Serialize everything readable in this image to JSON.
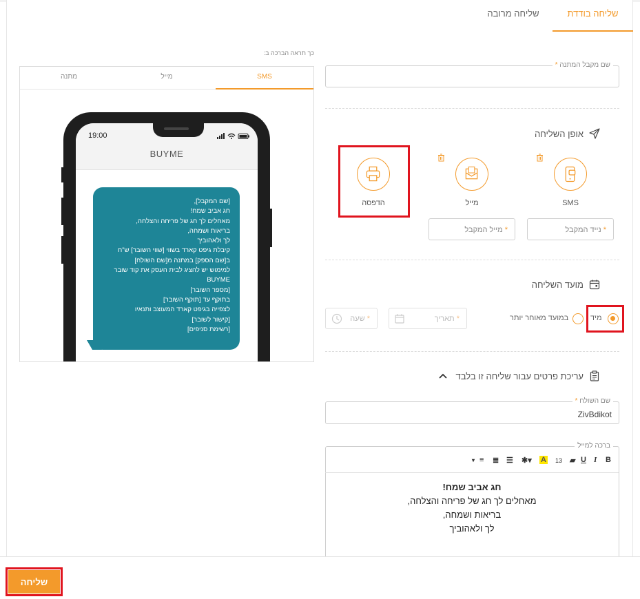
{
  "tabs": {
    "single": "שליחה בודדת",
    "multi": "שליחה מרובה"
  },
  "recipient": {
    "label": "שם מקבל המתנה",
    "required_mark": "*"
  },
  "delivery": {
    "title": "אופן השליחה",
    "options": [
      {
        "label": "SMS",
        "icon": "sms-phone-icon"
      },
      {
        "label": "מייל",
        "icon": "email-icon"
      },
      {
        "label": "הדפסה",
        "icon": "printer-icon"
      }
    ],
    "phone_field": "נייד המקבל",
    "email_field": "מייל המקבל"
  },
  "timing": {
    "title": "מועד השליחה",
    "now": "מיד",
    "later": "במועד מאוחר יותר",
    "date": "תאריך",
    "time": "שעה"
  },
  "edit": {
    "title": "עריכת פרטים עבור שליחה זו בלבד",
    "sender_label": "שם השולח",
    "sender_value": "ZivBdikot",
    "blessing_label": "ברכה למייל",
    "font_size": "13",
    "blessing_lines": [
      "חג אביב שמח!",
      "מאחלים לך חג של פריחה והצלחה,",
      "בריאות ושמחה,",
      "לך ולאהוביך"
    ]
  },
  "preview": {
    "caption": "כך תראה הברכה ב:",
    "tabs": [
      "SMS",
      "מייל",
      "מתנה"
    ],
    "clock": "19:00",
    "brand": "BUYME",
    "sms_lines": [
      "[שם המקבל],",
      "חג אביב שמח!",
      "מאחלים לך חג של פריחה והצלחה,",
      "בריאות ושמחה,",
      "לך ולאהוביך",
      "קיבלת גיפט קארד בשווי [שווי השובר] ש\"ח",
      "ב[שם הספק] במתנה מ[שם השולח]",
      "למימוש יש להציג לבית העסק את קוד שובר",
      "BUYME",
      "[מספר השובר]",
      "בתוקף עד [תוקף השובר]",
      "לצפייה בגיפט קארד המעוצב ותנאיו",
      "[קישור לשובר]",
      "[רשימת סניפים]"
    ]
  },
  "actions": {
    "send": "שליחה"
  },
  "colors": {
    "accent": "#f39a2b",
    "highlight": "#e0141e",
    "bubble": "#1e8597"
  }
}
